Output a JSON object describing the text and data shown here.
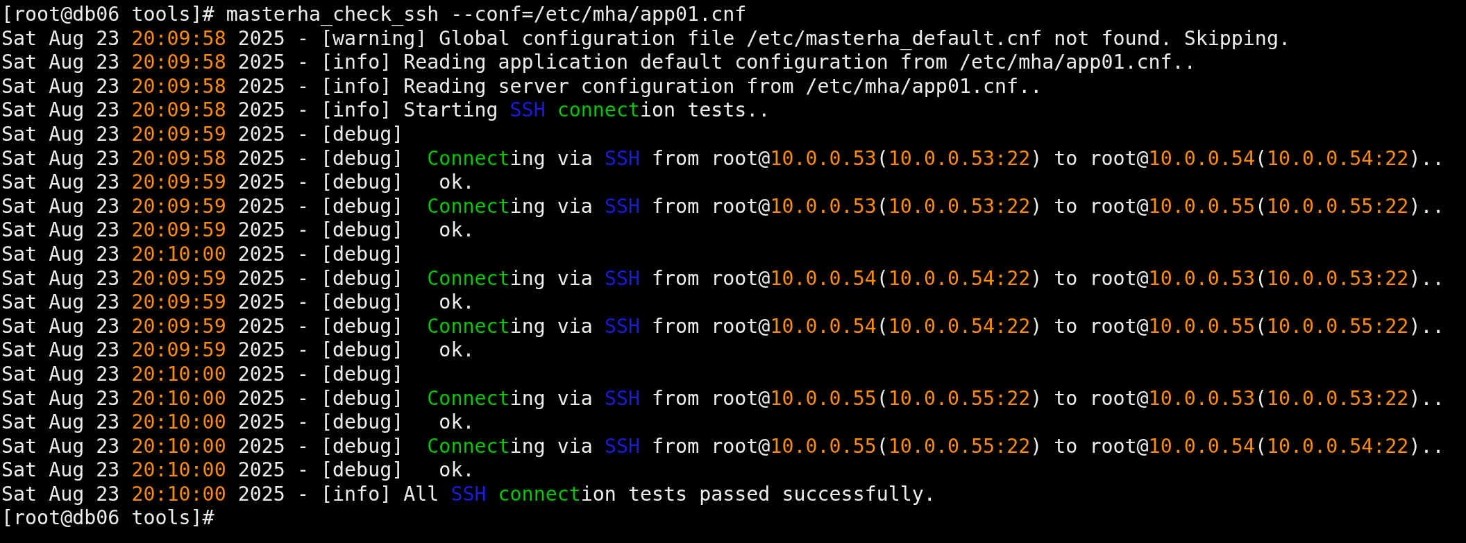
{
  "terminal": {
    "lines": [
      [
        {
          "kind": "text",
          "text": "[root@db06 tools]# masterha_check_ssh --conf=/etc/mha/app01.cnf"
        }
      ],
      [
        {
          "kind": "text",
          "text": "Sat Aug 23 "
        },
        {
          "kind": "value",
          "text": "20:09:58"
        },
        {
          "kind": "text",
          "text": " 2025 - [warning] Global configuration file /etc/masterha_default.cnf not found. Skipping."
        }
      ],
      [
        {
          "kind": "text",
          "text": "Sat Aug 23 "
        },
        {
          "kind": "value",
          "text": "20:09:58"
        },
        {
          "kind": "text",
          "text": " 2025 - [info] Reading application default configuration from /etc/mha/app01.cnf.."
        }
      ],
      [
        {
          "kind": "text",
          "text": "Sat Aug 23 "
        },
        {
          "kind": "value",
          "text": "20:09:58"
        },
        {
          "kind": "text",
          "text": " 2025 - [info] Reading server configuration from /etc/mha/app01.cnf.."
        }
      ],
      [
        {
          "kind": "text",
          "text": "Sat Aug 23 "
        },
        {
          "kind": "value",
          "text": "20:09:58"
        },
        {
          "kind": "text",
          "text": " 2025 - [info] Starting "
        },
        {
          "kind": "protocol",
          "text": "SSH"
        },
        {
          "kind": "keyword",
          "text": " connect"
        },
        {
          "kind": "text",
          "text": "ion tests.."
        }
      ],
      [
        {
          "kind": "text",
          "text": "Sat Aug 23 "
        },
        {
          "kind": "value",
          "text": "20:09:59"
        },
        {
          "kind": "text",
          "text": " 2025 - [debug]"
        }
      ],
      [
        {
          "kind": "text",
          "text": "Sat Aug 23 "
        },
        {
          "kind": "value",
          "text": "20:09:58"
        },
        {
          "kind": "text",
          "text": " 2025 - [debug]  "
        },
        {
          "kind": "keyword",
          "text": "Connect"
        },
        {
          "kind": "text",
          "text": "ing via "
        },
        {
          "kind": "protocol",
          "text": "SSH"
        },
        {
          "kind": "text",
          "text": " from root@"
        },
        {
          "kind": "value",
          "text": "10.0.0.53"
        },
        {
          "kind": "text",
          "text": "("
        },
        {
          "kind": "value",
          "text": "10.0.0.53:22"
        },
        {
          "kind": "text",
          "text": ") to root@"
        },
        {
          "kind": "value",
          "text": "10.0.0.54"
        },
        {
          "kind": "text",
          "text": "("
        },
        {
          "kind": "value",
          "text": "10.0.0.54:22"
        },
        {
          "kind": "text",
          "text": ").."
        }
      ],
      [
        {
          "kind": "text",
          "text": "Sat Aug 23 "
        },
        {
          "kind": "value",
          "text": "20:09:59"
        },
        {
          "kind": "text",
          "text": " 2025 - [debug]   ok."
        }
      ],
      [
        {
          "kind": "text",
          "text": "Sat Aug 23 "
        },
        {
          "kind": "value",
          "text": "20:09:59"
        },
        {
          "kind": "text",
          "text": " 2025 - [debug]  "
        },
        {
          "kind": "keyword",
          "text": "Connect"
        },
        {
          "kind": "text",
          "text": "ing via "
        },
        {
          "kind": "protocol",
          "text": "SSH"
        },
        {
          "kind": "text",
          "text": " from root@"
        },
        {
          "kind": "value",
          "text": "10.0.0.53"
        },
        {
          "kind": "text",
          "text": "("
        },
        {
          "kind": "value",
          "text": "10.0.0.53:22"
        },
        {
          "kind": "text",
          "text": ") to root@"
        },
        {
          "kind": "value",
          "text": "10.0.0.55"
        },
        {
          "kind": "text",
          "text": "("
        },
        {
          "kind": "value",
          "text": "10.0.0.55:22"
        },
        {
          "kind": "text",
          "text": ").."
        }
      ],
      [
        {
          "kind": "text",
          "text": "Sat Aug 23 "
        },
        {
          "kind": "value",
          "text": "20:09:59"
        },
        {
          "kind": "text",
          "text": " 2025 - [debug]   ok."
        }
      ],
      [
        {
          "kind": "text",
          "text": "Sat Aug 23 "
        },
        {
          "kind": "value",
          "text": "20:10:00"
        },
        {
          "kind": "text",
          "text": " 2025 - [debug]"
        }
      ],
      [
        {
          "kind": "text",
          "text": "Sat Aug 23 "
        },
        {
          "kind": "value",
          "text": "20:09:59"
        },
        {
          "kind": "text",
          "text": " 2025 - [debug]  "
        },
        {
          "kind": "keyword",
          "text": "Connect"
        },
        {
          "kind": "text",
          "text": "ing via "
        },
        {
          "kind": "protocol",
          "text": "SSH"
        },
        {
          "kind": "text",
          "text": " from root@"
        },
        {
          "kind": "value",
          "text": "10.0.0.54"
        },
        {
          "kind": "text",
          "text": "("
        },
        {
          "kind": "value",
          "text": "10.0.0.54:22"
        },
        {
          "kind": "text",
          "text": ") to root@"
        },
        {
          "kind": "value",
          "text": "10.0.0.53"
        },
        {
          "kind": "text",
          "text": "("
        },
        {
          "kind": "value",
          "text": "10.0.0.53:22"
        },
        {
          "kind": "text",
          "text": ").."
        }
      ],
      [
        {
          "kind": "text",
          "text": "Sat Aug 23 "
        },
        {
          "kind": "value",
          "text": "20:09:59"
        },
        {
          "kind": "text",
          "text": " 2025 - [debug]   ok."
        }
      ],
      [
        {
          "kind": "text",
          "text": "Sat Aug 23 "
        },
        {
          "kind": "value",
          "text": "20:09:59"
        },
        {
          "kind": "text",
          "text": " 2025 - [debug]  "
        },
        {
          "kind": "keyword",
          "text": "Connect"
        },
        {
          "kind": "text",
          "text": "ing via "
        },
        {
          "kind": "protocol",
          "text": "SSH"
        },
        {
          "kind": "text",
          "text": " from root@"
        },
        {
          "kind": "value",
          "text": "10.0.0.54"
        },
        {
          "kind": "text",
          "text": "("
        },
        {
          "kind": "value",
          "text": "10.0.0.54:22"
        },
        {
          "kind": "text",
          "text": ") to root@"
        },
        {
          "kind": "value",
          "text": "10.0.0.55"
        },
        {
          "kind": "text",
          "text": "("
        },
        {
          "kind": "value",
          "text": "10.0.0.55:22"
        },
        {
          "kind": "text",
          "text": ").."
        }
      ],
      [
        {
          "kind": "text",
          "text": "Sat Aug 23 "
        },
        {
          "kind": "value",
          "text": "20:09:59"
        },
        {
          "kind": "text",
          "text": " 2025 - [debug]   ok."
        }
      ],
      [
        {
          "kind": "text",
          "text": "Sat Aug 23 "
        },
        {
          "kind": "value",
          "text": "20:10:00"
        },
        {
          "kind": "text",
          "text": " 2025 - [debug]"
        }
      ],
      [
        {
          "kind": "text",
          "text": "Sat Aug 23 "
        },
        {
          "kind": "value",
          "text": "20:10:00"
        },
        {
          "kind": "text",
          "text": " 2025 - [debug]  "
        },
        {
          "kind": "keyword",
          "text": "Connect"
        },
        {
          "kind": "text",
          "text": "ing via "
        },
        {
          "kind": "protocol",
          "text": "SSH"
        },
        {
          "kind": "text",
          "text": " from root@"
        },
        {
          "kind": "value",
          "text": "10.0.0.55"
        },
        {
          "kind": "text",
          "text": "("
        },
        {
          "kind": "value",
          "text": "10.0.0.55:22"
        },
        {
          "kind": "text",
          "text": ") to root@"
        },
        {
          "kind": "value",
          "text": "10.0.0.53"
        },
        {
          "kind": "text",
          "text": "("
        },
        {
          "kind": "value",
          "text": "10.0.0.53:22"
        },
        {
          "kind": "text",
          "text": ").."
        }
      ],
      [
        {
          "kind": "text",
          "text": "Sat Aug 23 "
        },
        {
          "kind": "value",
          "text": "20:10:00"
        },
        {
          "kind": "text",
          "text": " 2025 - [debug]   ok."
        }
      ],
      [
        {
          "kind": "text",
          "text": "Sat Aug 23 "
        },
        {
          "kind": "value",
          "text": "20:10:00"
        },
        {
          "kind": "text",
          "text": " 2025 - [debug]  "
        },
        {
          "kind": "keyword",
          "text": "Connect"
        },
        {
          "kind": "text",
          "text": "ing via "
        },
        {
          "kind": "protocol",
          "text": "SSH"
        },
        {
          "kind": "text",
          "text": " from root@"
        },
        {
          "kind": "value",
          "text": "10.0.0.55"
        },
        {
          "kind": "text",
          "text": "("
        },
        {
          "kind": "value",
          "text": "10.0.0.55:22"
        },
        {
          "kind": "text",
          "text": ") to root@"
        },
        {
          "kind": "value",
          "text": "10.0.0.54"
        },
        {
          "kind": "text",
          "text": "("
        },
        {
          "kind": "value",
          "text": "10.0.0.54:22"
        },
        {
          "kind": "text",
          "text": ").."
        }
      ],
      [
        {
          "kind": "text",
          "text": "Sat Aug 23 "
        },
        {
          "kind": "value",
          "text": "20:10:00"
        },
        {
          "kind": "text",
          "text": " 2025 - [debug]   ok."
        }
      ],
      [
        {
          "kind": "text",
          "text": "Sat Aug 23 "
        },
        {
          "kind": "value",
          "text": "20:10:00"
        },
        {
          "kind": "text",
          "text": " 2025 - [info] All "
        },
        {
          "kind": "protocol",
          "text": "SSH"
        },
        {
          "kind": "keyword",
          "text": " connect"
        },
        {
          "kind": "text",
          "text": "ion tests passed successfully."
        }
      ],
      [
        {
          "kind": "text",
          "text": "[root@db06 tools]#"
        }
      ]
    ]
  }
}
